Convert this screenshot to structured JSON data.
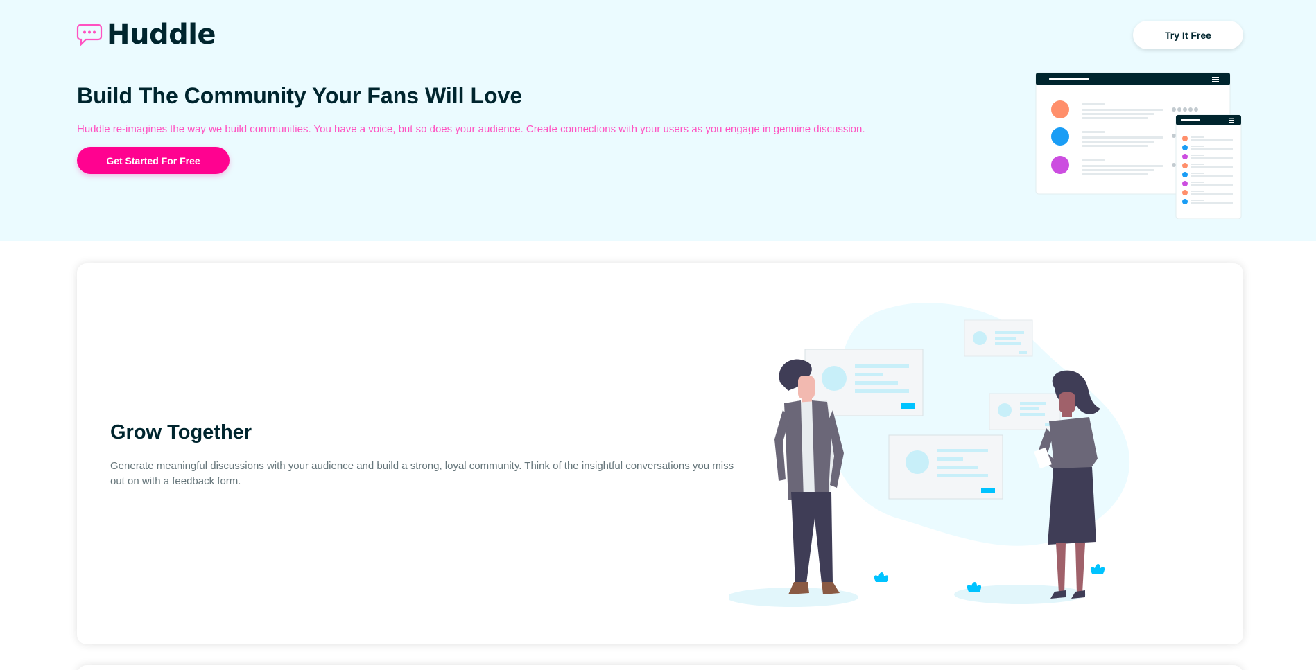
{
  "header": {
    "logo_text": "Huddle",
    "logo_icon": "chat-bubble-icon",
    "try_button_label": "Try It Free"
  },
  "hero": {
    "title": "Build The Community Your Fans Will Love",
    "description": "Huddle re-imagines the way we build communities. You have a voice, but so does your audience. Create connections with your users as you engage in genuine discussion.",
    "cta_label": "Get Started For Free"
  },
  "features": [
    {
      "title": "Grow Together",
      "description": "Generate meaningful discussions with your audience and build a strong, loyal community. Think of the insightful conversations you miss out on with a feedback form."
    }
  ],
  "colors": {
    "hero_bg": "#ebfbff",
    "brand_pink": "#ff0290",
    "pink_text": "#ff52c1",
    "dark_navy": "#00252e",
    "body_grey": "#65757a"
  }
}
